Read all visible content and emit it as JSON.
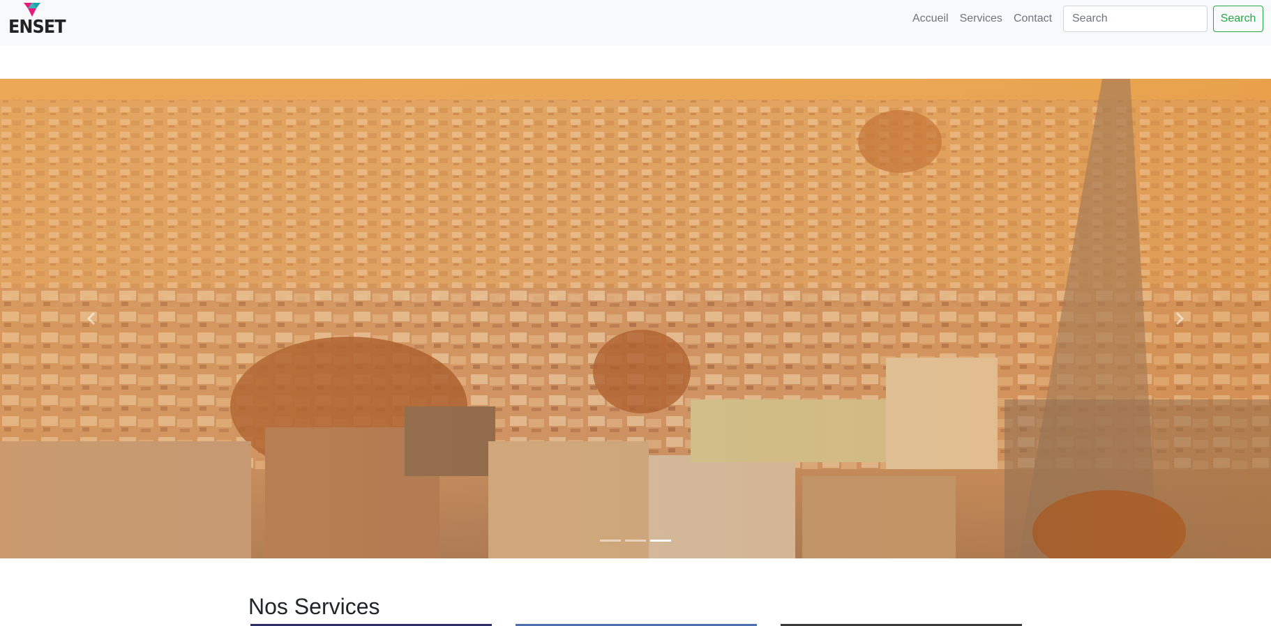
{
  "navbar": {
    "brand": {
      "text": "ENSET",
      "colors": {
        "mark_pink": "#e6197d",
        "mark_teal": "#1aa6a8"
      }
    },
    "links": [
      {
        "label": "Accueil"
      },
      {
        "label": "Services"
      },
      {
        "label": "Contact"
      }
    ],
    "search": {
      "placeholder": "Search",
      "value": "",
      "button_label": "Search",
      "accent": "#28a745"
    }
  },
  "carousel": {
    "image": "city-aerial-sunset",
    "prev_icon": "chevron-left-icon",
    "next_icon": "chevron-right-icon",
    "indicator_count": 3,
    "active_indicator": 3
  },
  "services": {
    "title": "Nos Services",
    "card_count": 3
  }
}
